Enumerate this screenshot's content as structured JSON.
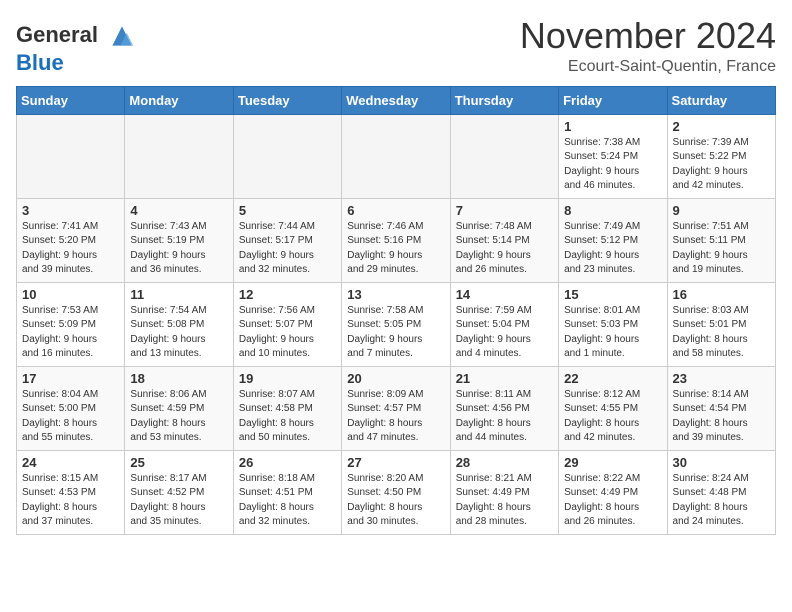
{
  "header": {
    "logo_general": "General",
    "logo_blue": "Blue",
    "month_title": "November 2024",
    "location": "Ecourt-Saint-Quentin, France"
  },
  "columns": [
    "Sunday",
    "Monday",
    "Tuesday",
    "Wednesday",
    "Thursday",
    "Friday",
    "Saturday"
  ],
  "weeks": [
    {
      "days": [
        {
          "num": "",
          "info": "",
          "empty": true
        },
        {
          "num": "",
          "info": "",
          "empty": true
        },
        {
          "num": "",
          "info": "",
          "empty": true
        },
        {
          "num": "",
          "info": "",
          "empty": true
        },
        {
          "num": "",
          "info": "",
          "empty": true
        },
        {
          "num": "1",
          "info": "Sunrise: 7:38 AM\nSunset: 5:24 PM\nDaylight: 9 hours\nand 46 minutes."
        },
        {
          "num": "2",
          "info": "Sunrise: 7:39 AM\nSunset: 5:22 PM\nDaylight: 9 hours\nand 42 minutes."
        }
      ]
    },
    {
      "days": [
        {
          "num": "3",
          "info": "Sunrise: 7:41 AM\nSunset: 5:20 PM\nDaylight: 9 hours\nand 39 minutes."
        },
        {
          "num": "4",
          "info": "Sunrise: 7:43 AM\nSunset: 5:19 PM\nDaylight: 9 hours\nand 36 minutes."
        },
        {
          "num": "5",
          "info": "Sunrise: 7:44 AM\nSunset: 5:17 PM\nDaylight: 9 hours\nand 32 minutes."
        },
        {
          "num": "6",
          "info": "Sunrise: 7:46 AM\nSunset: 5:16 PM\nDaylight: 9 hours\nand 29 minutes."
        },
        {
          "num": "7",
          "info": "Sunrise: 7:48 AM\nSunset: 5:14 PM\nDaylight: 9 hours\nand 26 minutes."
        },
        {
          "num": "8",
          "info": "Sunrise: 7:49 AM\nSunset: 5:12 PM\nDaylight: 9 hours\nand 23 minutes."
        },
        {
          "num": "9",
          "info": "Sunrise: 7:51 AM\nSunset: 5:11 PM\nDaylight: 9 hours\nand 19 minutes."
        }
      ]
    },
    {
      "days": [
        {
          "num": "10",
          "info": "Sunrise: 7:53 AM\nSunset: 5:09 PM\nDaylight: 9 hours\nand 16 minutes."
        },
        {
          "num": "11",
          "info": "Sunrise: 7:54 AM\nSunset: 5:08 PM\nDaylight: 9 hours\nand 13 minutes."
        },
        {
          "num": "12",
          "info": "Sunrise: 7:56 AM\nSunset: 5:07 PM\nDaylight: 9 hours\nand 10 minutes."
        },
        {
          "num": "13",
          "info": "Sunrise: 7:58 AM\nSunset: 5:05 PM\nDaylight: 9 hours\nand 7 minutes."
        },
        {
          "num": "14",
          "info": "Sunrise: 7:59 AM\nSunset: 5:04 PM\nDaylight: 9 hours\nand 4 minutes."
        },
        {
          "num": "15",
          "info": "Sunrise: 8:01 AM\nSunset: 5:03 PM\nDaylight: 9 hours\nand 1 minute."
        },
        {
          "num": "16",
          "info": "Sunrise: 8:03 AM\nSunset: 5:01 PM\nDaylight: 8 hours\nand 58 minutes."
        }
      ]
    },
    {
      "days": [
        {
          "num": "17",
          "info": "Sunrise: 8:04 AM\nSunset: 5:00 PM\nDaylight: 8 hours\nand 55 minutes."
        },
        {
          "num": "18",
          "info": "Sunrise: 8:06 AM\nSunset: 4:59 PM\nDaylight: 8 hours\nand 53 minutes."
        },
        {
          "num": "19",
          "info": "Sunrise: 8:07 AM\nSunset: 4:58 PM\nDaylight: 8 hours\nand 50 minutes."
        },
        {
          "num": "20",
          "info": "Sunrise: 8:09 AM\nSunset: 4:57 PM\nDaylight: 8 hours\nand 47 minutes."
        },
        {
          "num": "21",
          "info": "Sunrise: 8:11 AM\nSunset: 4:56 PM\nDaylight: 8 hours\nand 44 minutes."
        },
        {
          "num": "22",
          "info": "Sunrise: 8:12 AM\nSunset: 4:55 PM\nDaylight: 8 hours\nand 42 minutes."
        },
        {
          "num": "23",
          "info": "Sunrise: 8:14 AM\nSunset: 4:54 PM\nDaylight: 8 hours\nand 39 minutes."
        }
      ]
    },
    {
      "days": [
        {
          "num": "24",
          "info": "Sunrise: 8:15 AM\nSunset: 4:53 PM\nDaylight: 8 hours\nand 37 minutes."
        },
        {
          "num": "25",
          "info": "Sunrise: 8:17 AM\nSunset: 4:52 PM\nDaylight: 8 hours\nand 35 minutes."
        },
        {
          "num": "26",
          "info": "Sunrise: 8:18 AM\nSunset: 4:51 PM\nDaylight: 8 hours\nand 32 minutes."
        },
        {
          "num": "27",
          "info": "Sunrise: 8:20 AM\nSunset: 4:50 PM\nDaylight: 8 hours\nand 30 minutes."
        },
        {
          "num": "28",
          "info": "Sunrise: 8:21 AM\nSunset: 4:49 PM\nDaylight: 8 hours\nand 28 minutes."
        },
        {
          "num": "29",
          "info": "Sunrise: 8:22 AM\nSunset: 4:49 PM\nDaylight: 8 hours\nand 26 minutes."
        },
        {
          "num": "30",
          "info": "Sunrise: 8:24 AM\nSunset: 4:48 PM\nDaylight: 8 hours\nand 24 minutes."
        }
      ]
    }
  ]
}
